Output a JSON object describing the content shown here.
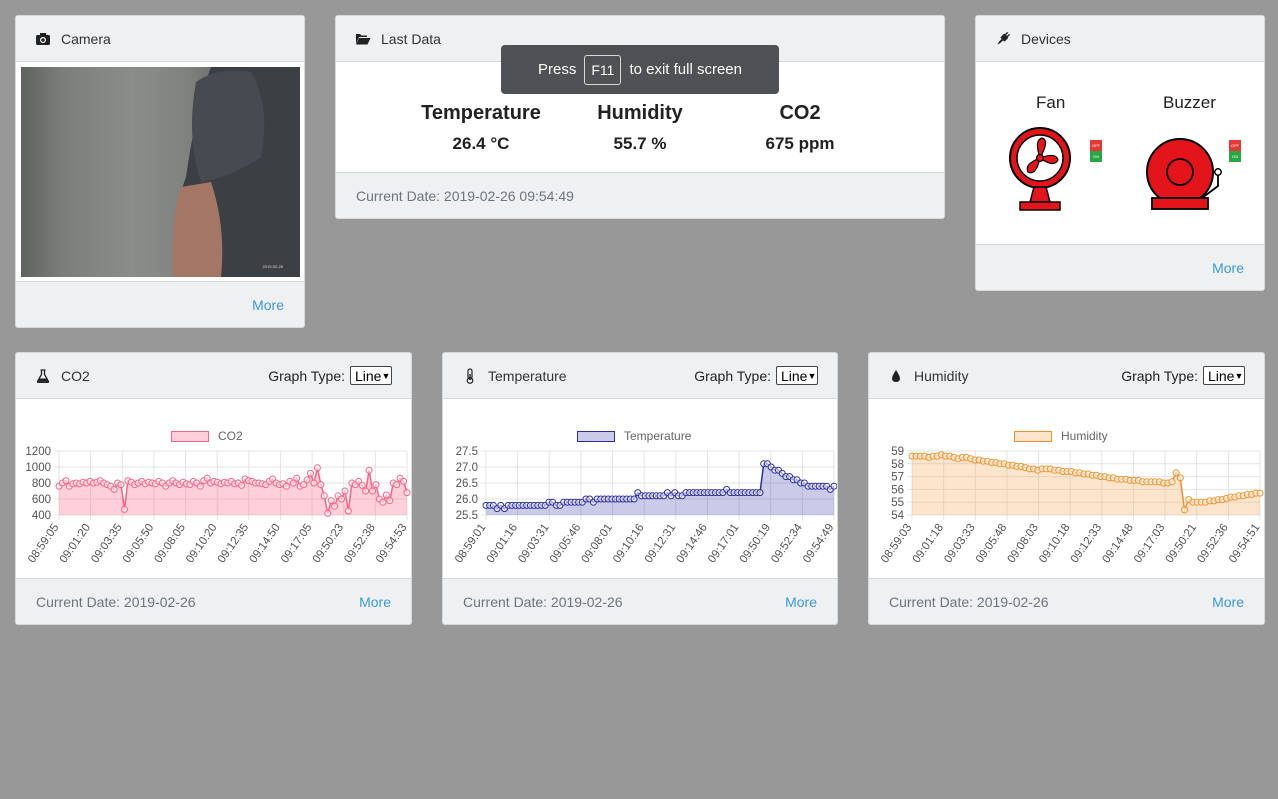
{
  "camera": {
    "title": "Camera",
    "more": "More",
    "icon": "camera-icon"
  },
  "last_data": {
    "title": "Last Data",
    "metrics": [
      {
        "label": "Temperature",
        "value": "26.4 °C"
      },
      {
        "label": "Humidity",
        "value": "55.7 %"
      },
      {
        "label": "CO2",
        "value": "675 ppm"
      }
    ],
    "current_date": "Current Date: 2019-02-26 09:54:49"
  },
  "toast": {
    "press": "Press",
    "key": "F11",
    "rest": "to exit full screen"
  },
  "devices": {
    "title": "Devices",
    "fan": "Fan",
    "buzzer": "Buzzer",
    "switch_off": "OFF",
    "switch_on": "ON",
    "more": "More"
  },
  "graph_type_label": "Graph Type:",
  "graph_type_value": "Line",
  "date_footer": "Current Date: 2019-02-26",
  "more": "More",
  "chart_data": [
    {
      "type": "area",
      "panel_title": "CO2",
      "series_name": "CO2",
      "color": "#ff6384",
      "fill": "rgba(255,99,132,0.3)",
      "ylim": [
        400,
        1200
      ],
      "yticks": [
        400,
        600,
        800,
        1000,
        1200
      ],
      "xticks": [
        "08:59:05",
        "09:01:20",
        "09:03:35",
        "09:05:50",
        "09:08:05",
        "09:10:20",
        "09:12:35",
        "09:14:50",
        "09:17:05",
        "09:50:23",
        "09:52:38",
        "09:54:53"
      ],
      "values": [
        760,
        800,
        830,
        760,
        790,
        800,
        790,
        810,
        800,
        820,
        800,
        810,
        830,
        800,
        780,
        760,
        720,
        800,
        780,
        470,
        830,
        810,
        780,
        800,
        820,
        790,
        810,
        800,
        790,
        820,
        800,
        760,
        800,
        830,
        800,
        780,
        810,
        790,
        780,
        820,
        800,
        760,
        830,
        860,
        800,
        820,
        810,
        790,
        810,
        800,
        820,
        790,
        800,
        770,
        850,
        830,
        820,
        800,
        800,
        790,
        780,
        820,
        850,
        800,
        780,
        790,
        760,
        820,
        800,
        860,
        760,
        780,
        840,
        920,
        800,
        990,
        780,
        640,
        420,
        580,
        510,
        640,
        600,
        700,
        450,
        800,
        780,
        820,
        770,
        700,
        960,
        700,
        780,
        600,
        560,
        650,
        580,
        800,
        780,
        860,
        820,
        680
      ]
    },
    {
      "type": "area",
      "panel_title": "Temperature",
      "series_name": "Temperature",
      "color": "#2c2fa3",
      "fill": "rgba(44,47,163,0.25)",
      "ylim": [
        25.5,
        27.5
      ],
      "yticks": [
        25.5,
        26.0,
        26.5,
        27.0,
        27.5
      ],
      "xticks": [
        "08:59:01",
        "09:01:16",
        "09:03:31",
        "09:05:46",
        "09:08:01",
        "09:10:16",
        "09:12:31",
        "09:14:46",
        "09:17:01",
        "09:50:19",
        "09:52:34",
        "09:54:49"
      ],
      "values": [
        25.8,
        25.8,
        25.8,
        25.7,
        25.8,
        25.7,
        25.8,
        25.8,
        25.8,
        25.8,
        25.8,
        25.8,
        25.8,
        25.8,
        25.8,
        25.8,
        25.8,
        25.9,
        25.9,
        25.8,
        25.8,
        25.9,
        25.9,
        25.9,
        25.9,
        25.9,
        25.9,
        26.0,
        26.0,
        25.9,
        26.0,
        26.0,
        26.0,
        26.0,
        26.0,
        26.0,
        26.0,
        26.0,
        26.0,
        26.0,
        26.0,
        26.2,
        26.1,
        26.1,
        26.1,
        26.1,
        26.1,
        26.1,
        26.1,
        26.2,
        26.1,
        26.2,
        26.1,
        26.1,
        26.2,
        26.2,
        26.2,
        26.2,
        26.2,
        26.2,
        26.2,
        26.2,
        26.2,
        26.2,
        26.2,
        26.3,
        26.2,
        26.2,
        26.2,
        26.2,
        26.2,
        26.2,
        26.2,
        26.2,
        26.2,
        27.1,
        27.1,
        27.0,
        26.9,
        26.9,
        26.8,
        26.7,
        26.7,
        26.6,
        26.6,
        26.5,
        26.5,
        26.4,
        26.4,
        26.4,
        26.4,
        26.4,
        26.4,
        26.3,
        26.4
      ]
    },
    {
      "type": "area",
      "panel_title": "Humidity",
      "series_name": "Humidity",
      "color": "#f0922b",
      "fill": "rgba(247,168,90,0.3)",
      "ylim": [
        54,
        59
      ],
      "yticks": [
        54,
        55,
        56,
        57,
        58,
        59
      ],
      "xticks": [
        "08:59:03",
        "09:01:18",
        "09:03:33",
        "09:05:48",
        "09:08:03",
        "09:10:18",
        "09:12:33",
        "09:14:48",
        "09:17:03",
        "09:50:21",
        "09:52:36",
        "09:54:51"
      ],
      "values": [
        58.6,
        58.6,
        58.6,
        58.6,
        58.5,
        58.6,
        58.6,
        58.7,
        58.6,
        58.6,
        58.5,
        58.4,
        58.5,
        58.5,
        58.4,
        58.3,
        58.3,
        58.2,
        58.2,
        58.1,
        58.1,
        58.0,
        58.0,
        57.9,
        57.9,
        57.8,
        57.8,
        57.7,
        57.6,
        57.6,
        57.5,
        57.6,
        57.6,
        57.6,
        57.5,
        57.5,
        57.4,
        57.4,
        57.4,
        57.3,
        57.3,
        57.2,
        57.2,
        57.1,
        57.1,
        57.0,
        57.0,
        56.9,
        56.9,
        56.8,
        56.8,
        56.8,
        56.7,
        56.7,
        56.7,
        56.6,
        56.6,
        56.6,
        56.6,
        56.6,
        56.5,
        56.5,
        56.6,
        57.3,
        56.9,
        54.4,
        55.2,
        55.0,
        55.0,
        55.0,
        55.0,
        55.1,
        55.1,
        55.2,
        55.2,
        55.3,
        55.4,
        55.4,
        55.5,
        55.5,
        55.6,
        55.6,
        55.7,
        55.7
      ]
    }
  ]
}
